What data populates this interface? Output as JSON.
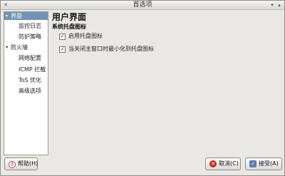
{
  "window": {
    "title": "首选项",
    "close_glyph": "✕",
    "min_glyph": "▾",
    "max_glyph": "▴"
  },
  "sidebar": {
    "items": [
      {
        "label": "界面",
        "expanded": true,
        "selected": true
      },
      {
        "label": "监控日志"
      },
      {
        "label": "防护策略"
      },
      {
        "label": "防火墙",
        "expanded": true
      },
      {
        "label": "网络配置"
      },
      {
        "label": "ICMP 拦截"
      },
      {
        "label": "ToS 优化"
      },
      {
        "label": "高级选项"
      }
    ],
    "expand_glyph": "▾"
  },
  "main": {
    "title": "用户界面",
    "section": "系统托盘图标",
    "options": [
      {
        "label": "启用托盘图标",
        "checked": true
      },
      {
        "label": "当关闭主窗口时最小化到托盘图标",
        "checked": true
      }
    ],
    "check_glyph": "✓"
  },
  "buttons": {
    "help": "帮助(H)",
    "cancel": "取消(C)",
    "accept": "接受(A)"
  },
  "icons": {
    "help": "help-icon",
    "cancel": "cancel-icon",
    "accept": "accept-icon"
  }
}
